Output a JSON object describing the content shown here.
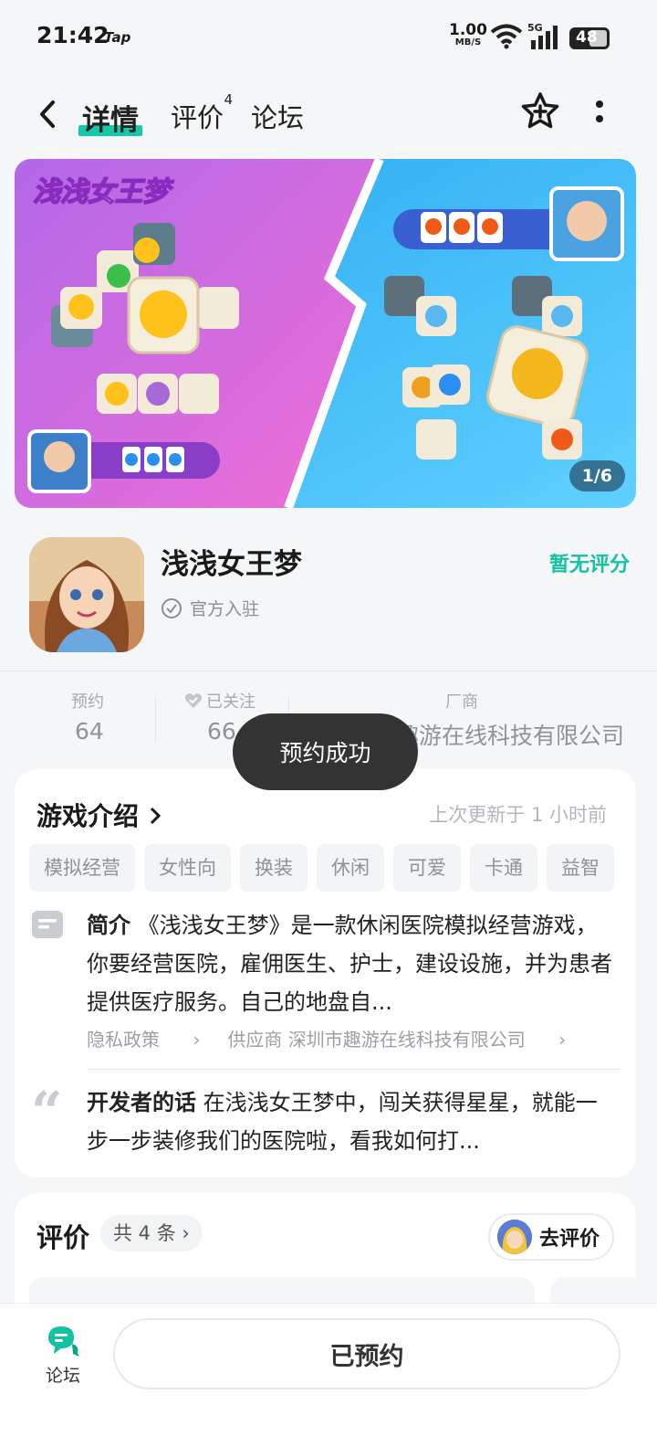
{
  "status_bar": {
    "time": "21:42",
    "app_badge": "Tap",
    "speed_value": "1.00",
    "speed_unit": "MB/S",
    "network": "5G",
    "battery": "48"
  },
  "nav": {
    "tabs": [
      {
        "label": "详情",
        "active": true
      },
      {
        "label": "评价",
        "badge": "4"
      },
      {
        "label": "论坛"
      }
    ]
  },
  "banner": {
    "title_art": "浅浅女王梦",
    "counter": "1/6"
  },
  "app": {
    "name": "浅浅女王梦",
    "official_label": "官方入驻",
    "rating_text": "暂无评分"
  },
  "stats": [
    {
      "label": "预约",
      "value": "64"
    },
    {
      "label": "已关注",
      "value": "66"
    },
    {
      "label": "厂商",
      "value": "深圳市趣游在线科技有限公司"
    }
  ],
  "toast": "预约成功",
  "intro": {
    "title": "游戏介绍",
    "updated": "上次更新于 1 小时前",
    "tags": [
      "模拟经营",
      "女性向",
      "换装",
      "休闲",
      "可爱",
      "卡通",
      "益智"
    ],
    "summary_label": "简介",
    "summary_text": "《浅浅女王梦》是一款休闲医院模拟经营游戏，你要经营医院，雇佣医生、护士，建设设施，并为患者提供医疗服务。自己的地盘自...",
    "privacy_link": "隐私政策",
    "supplier_link": "供应商 深圳市趣游在线科技有限公司",
    "dev_label": "开发者的话",
    "dev_text": "在浅浅女王梦中，闯关获得星星，就能一步一步装修我们的医院啦，看我如何打..."
  },
  "reviews": {
    "title": "评价",
    "count": "共 4 条",
    "go_review": "去评价"
  },
  "bottom": {
    "forum_label": "论坛",
    "reserve_button": "已预约"
  },
  "colors": {
    "accent": "#13c2a0",
    "background": "#f4f6f8",
    "toast_bg": "#333333"
  }
}
